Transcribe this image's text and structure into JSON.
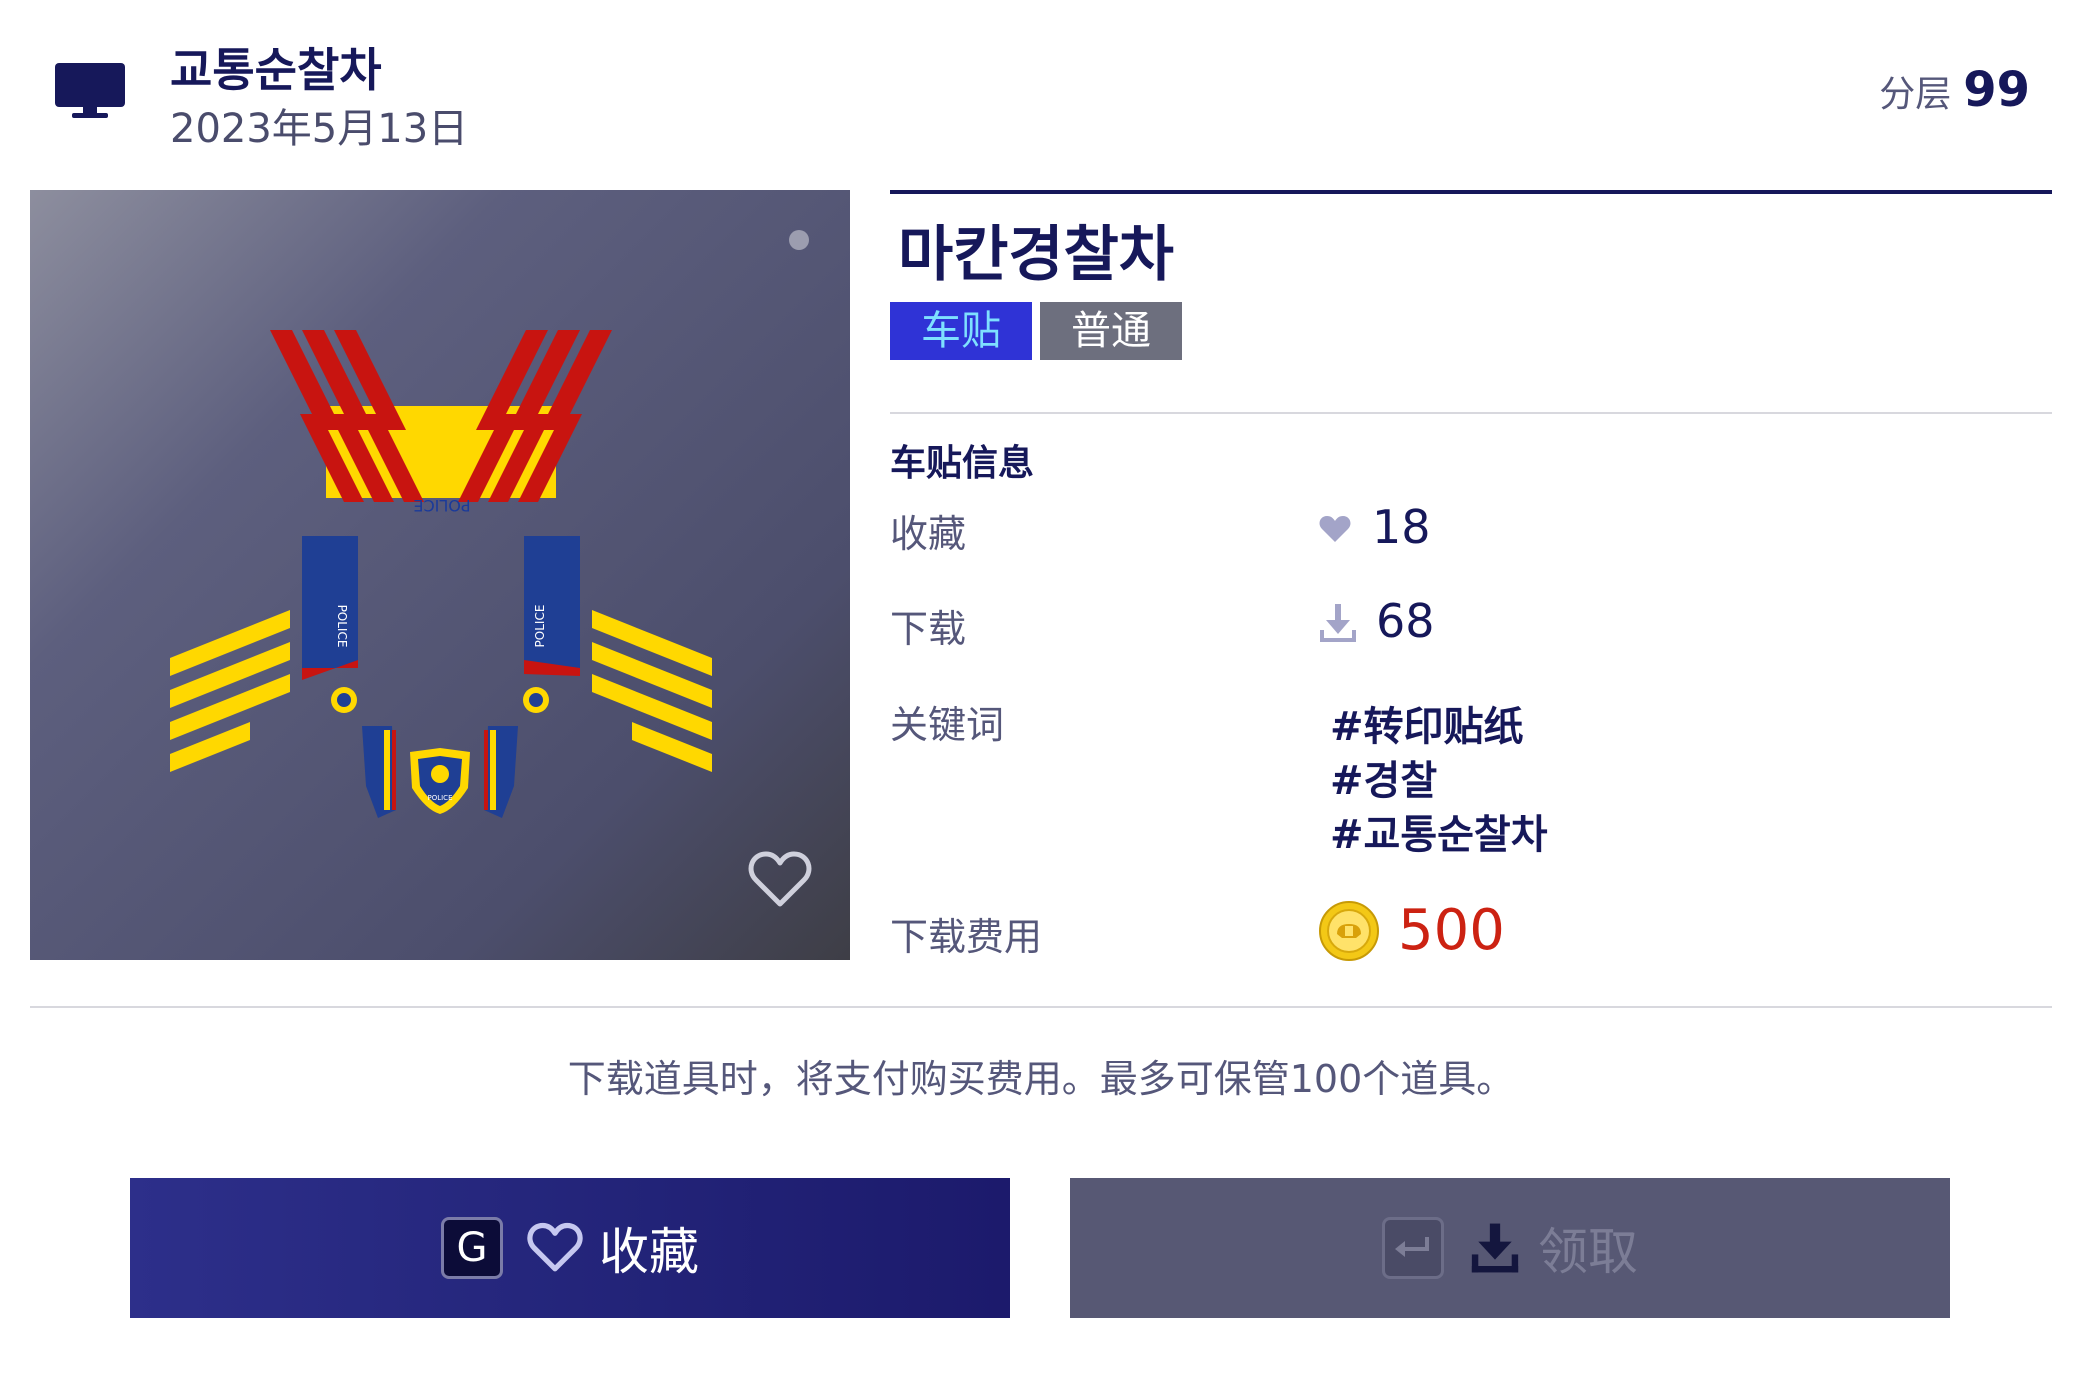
{
  "header": {
    "author_name": "교통순찰차",
    "date": "2023年5月13日",
    "layer_label": "分层",
    "layer_value": "99",
    "icon": "monitor-icon"
  },
  "preview": {
    "decal_text_top": "POLICE",
    "decal_text_side": "POLICE",
    "badge_text": "POLICE",
    "icons": [
      "heart-outline-icon",
      "page-dot-icon"
    ]
  },
  "item": {
    "title": "마칸경찰차",
    "tags": {
      "type": "车贴",
      "rarity": "普通"
    },
    "section_title": "车贴信息",
    "favorites_label": "收藏",
    "favorites_count": "18",
    "downloads_label": "下载",
    "downloads_count": "68",
    "keywords_label": "关键词",
    "keywords": [
      "#转印贴纸",
      "#경찰",
      "#교통순찰차"
    ],
    "cost_label": "下载费用",
    "cost_value": "500"
  },
  "notice": "下载道具时，将支付购买费用。最多可保管100个道具。",
  "buttons": {
    "favorite": {
      "key": "G",
      "label": "收藏",
      "icon": "heart-outline-icon"
    },
    "claim": {
      "key": "↵",
      "label": "领取",
      "icon": "download-icon"
    }
  },
  "colors": {
    "navy": "#16185a",
    "tag_type_bg": "#2f33d6",
    "tag_rarity_bg": "#6d6f7e",
    "cost_red": "#cc2212",
    "btn_favorite": "#232479",
    "btn_claim": "#575874"
  }
}
